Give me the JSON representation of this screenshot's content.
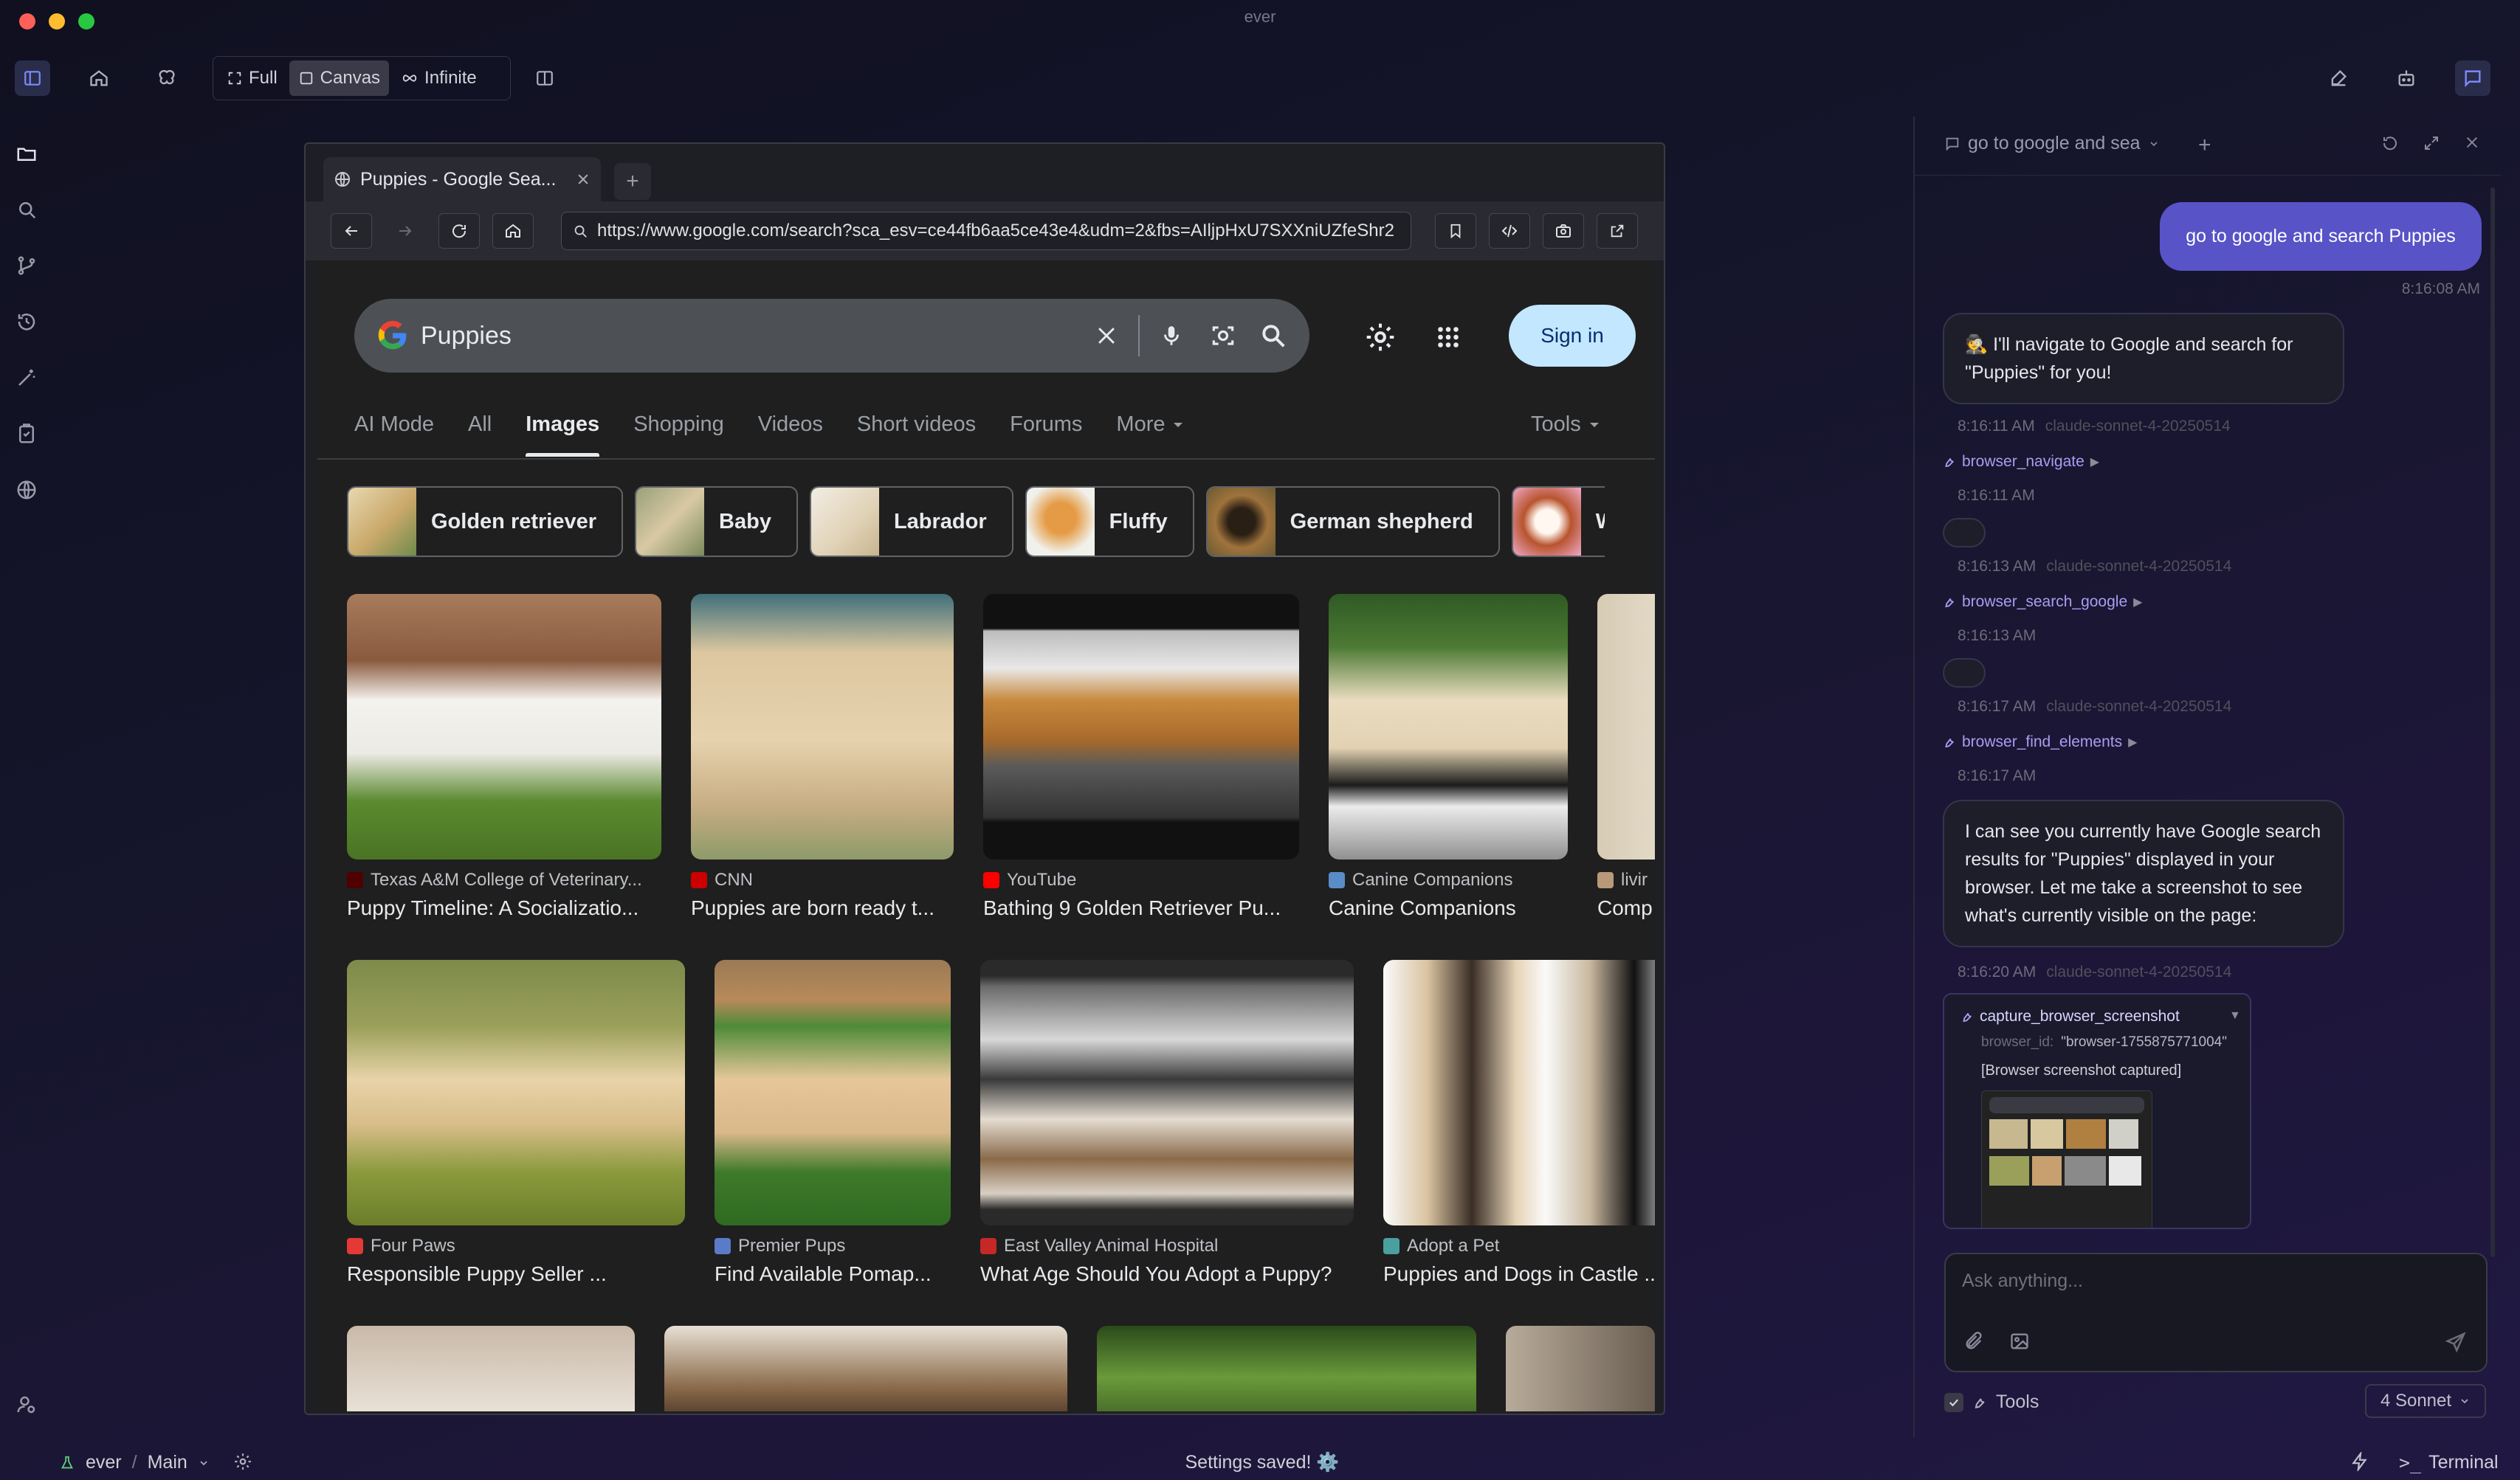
{
  "window": {
    "title": "ever"
  },
  "toolbar": {
    "modes": [
      {
        "label": "Full",
        "active": false
      },
      {
        "label": "Canvas",
        "active": true
      },
      {
        "label": "Infinite",
        "active": false
      }
    ]
  },
  "browser": {
    "tab_title": "Puppies - Google Sea...",
    "url": "https://www.google.com/search?sca_esv=ce44fb6aa5ce43e4&udm=2&fbs=AIljpHxU7SXXniUZfeShr2"
  },
  "google": {
    "query": "Puppies",
    "sign_in": "Sign in",
    "tabs": [
      "AI Mode",
      "All",
      "Images",
      "Shopping",
      "Videos",
      "Short videos",
      "Forums",
      "More"
    ],
    "active_tab": "Images",
    "tools": "Tools",
    "chips": [
      "Golden retriever",
      "Baby",
      "Labrador",
      "Fluffy",
      "German shepherd",
      "Wa"
    ],
    "results": [
      {
        "source": "Texas A&M College of Veterinary...",
        "title": "Puppy Timeline: A Socializatio..."
      },
      {
        "source": "CNN",
        "title": "Puppies are born ready t..."
      },
      {
        "source": "YouTube",
        "title": "Bathing 9 Golden Retriever Pu..."
      },
      {
        "source": "Canine Companions",
        "title": "Canine Companions"
      },
      {
        "source": "livir",
        "title": "Comp"
      },
      {
        "source": "Four Paws",
        "title": "Responsible Puppy Seller ..."
      },
      {
        "source": "Premier Pups",
        "title": "Find Available Pomap..."
      },
      {
        "source": "East Valley Animal Hospital",
        "title": "What Age Should You Adopt a Puppy?"
      },
      {
        "source": "Adopt a Pet",
        "title": "Puppies and Dogs in Castle ..."
      }
    ]
  },
  "chat": {
    "conversation_title": "go to google and sea",
    "user_message": "go to google and search Puppies",
    "user_time": "8:16:08 AM",
    "assistant_1": "🕵️ I'll navigate to Google and search for \"Puppies\" for you!",
    "meta_1": "8:16:11 AM",
    "model": "claude-sonnet-4-20250514",
    "tool_1": "browser_navigate",
    "tool_1_time": "8:16:11 AM",
    "meta_2": "8:16:13 AM",
    "tool_2": "browser_search_google",
    "tool_2_time": "8:16:13 AM",
    "meta_3": "8:16:17 AM",
    "tool_3": "browser_find_elements",
    "tool_3_time": "8:16:17 AM",
    "assistant_2": "I can see you currently have Google search results for \"Puppies\" displayed in your browser. Let me take a screenshot to see what's currently visible on the page:",
    "meta_4": "8:16:20 AM",
    "tool_4": "capture_browser_screenshot",
    "tool_4_param_key": "browser_id:",
    "tool_4_param_val": "\"browser-1755875771004\"",
    "tool_4_result": "[Browser screenshot captured]",
    "input_placeholder": "Ask anything...",
    "tools_label": "Tools",
    "model_select": "4 Sonnet"
  },
  "status": {
    "workspace": "ever",
    "branch": "Main",
    "message": "Settings saved! ⚙️",
    "terminal": "Terminal"
  }
}
